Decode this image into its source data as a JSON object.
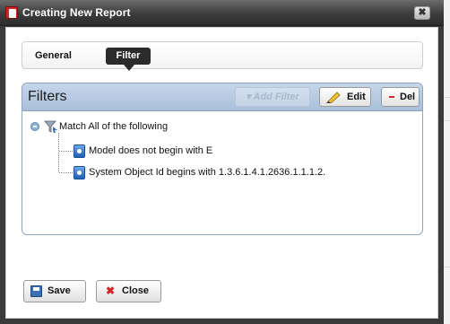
{
  "window": {
    "title": "Creating New Report",
    "close_glyph": "✖"
  },
  "tabs": [
    {
      "label": "General",
      "selected": false
    },
    {
      "label": "Filter",
      "selected": true
    }
  ],
  "filters_panel": {
    "title": "Filters",
    "add_filter_label": "▾ Add Filter",
    "add_filter_enabled": false,
    "edit_label": "Edit",
    "del_label": "Del"
  },
  "tree": {
    "root": {
      "label": "Match All of the following",
      "expanded": true,
      "icon": "filter-funnel-icon"
    },
    "children": [
      {
        "label": "Model does not begin with E",
        "icon": "condition-icon"
      },
      {
        "label": "System Object Id begins with 1.3.6.1.4.1.2636.1.1.1.2.",
        "icon": "condition-icon"
      }
    ]
  },
  "footer": {
    "save_label": "Save",
    "close_label": "Close",
    "close_glyph": "✖"
  },
  "colors": {
    "titlebar": "#3c3c3c",
    "panel_header": "#b8cbe3",
    "selected_tab": "#2b2b2b",
    "delete_accent": "#d32a2a"
  }
}
